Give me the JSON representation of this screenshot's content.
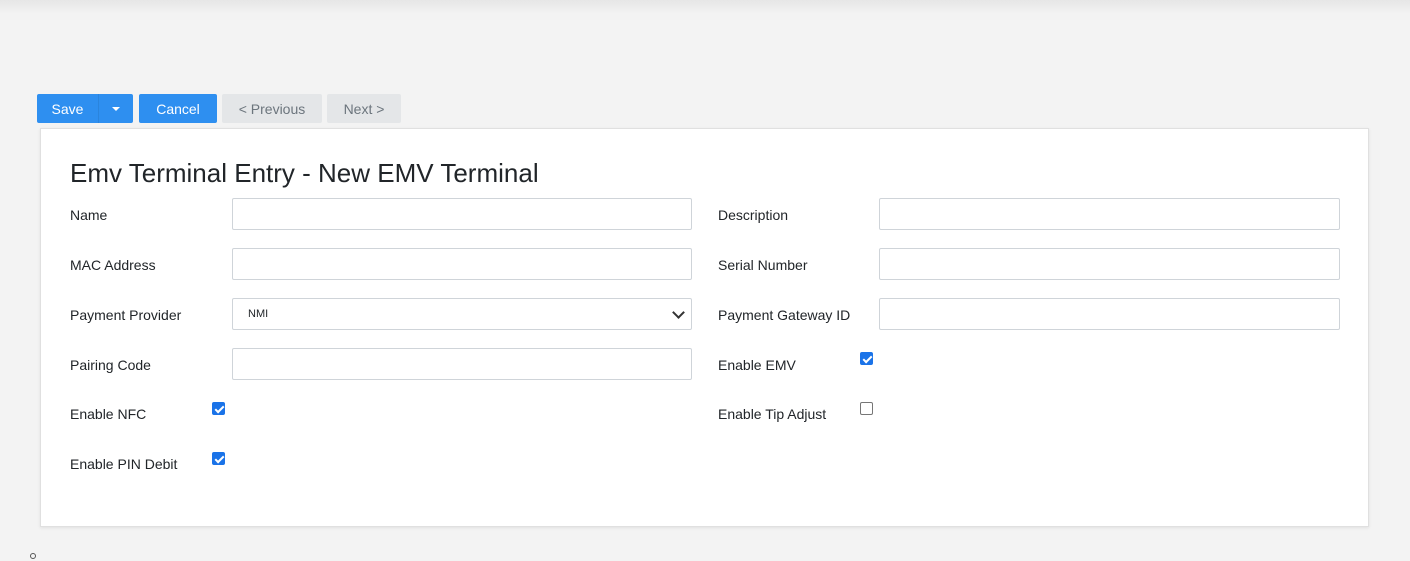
{
  "toolbar": {
    "save_label": "Save",
    "cancel_label": "Cancel",
    "previous_label": "< Previous",
    "next_label": "Next >"
  },
  "form": {
    "title": "Emv Terminal Entry - New EMV Terminal",
    "fields": {
      "name": {
        "label": "Name",
        "value": ""
      },
      "description": {
        "label": "Description",
        "value": ""
      },
      "mac_address": {
        "label": "MAC Address",
        "value": ""
      },
      "serial_number": {
        "label": "Serial Number",
        "value": ""
      },
      "payment_provider": {
        "label": "Payment Provider",
        "value": "NMI"
      },
      "payment_gateway_id": {
        "label": "Payment Gateway ID",
        "value": ""
      },
      "pairing_code": {
        "label": "Pairing Code",
        "value": ""
      },
      "enable_emv": {
        "label": "Enable EMV",
        "checked": true
      },
      "enable_nfc": {
        "label": "Enable NFC",
        "checked": true
      },
      "enable_tip_adjust": {
        "label": "Enable Tip Adjust",
        "checked": false
      },
      "enable_pin_debit": {
        "label": "Enable PIN Debit",
        "checked": true
      }
    }
  }
}
